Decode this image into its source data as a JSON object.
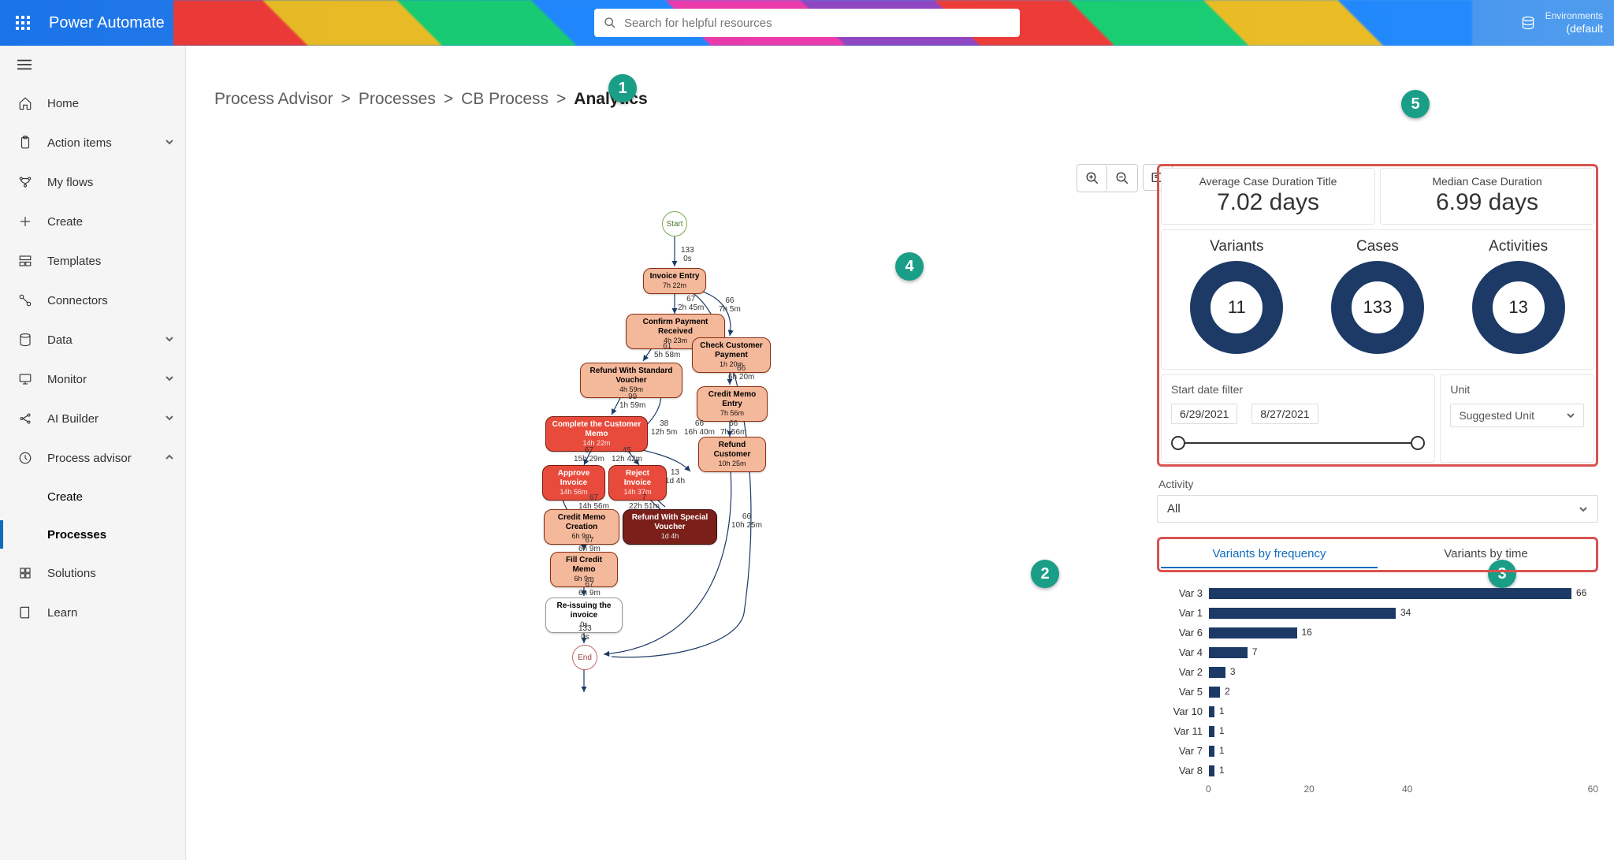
{
  "header": {
    "app_title": "Power Automate",
    "search_placeholder": "Search for helpful resources",
    "env_label": "Environments",
    "env_value": "(default"
  },
  "sidebar": {
    "items": [
      {
        "label": "Home",
        "icon": "home"
      },
      {
        "label": "Action items",
        "icon": "clipboard",
        "chevron": "down"
      },
      {
        "label": "My flows",
        "icon": "flow"
      },
      {
        "label": "Create",
        "icon": "plus"
      },
      {
        "label": "Templates",
        "icon": "templates"
      },
      {
        "label": "Connectors",
        "icon": "connectors"
      },
      {
        "label": "Data",
        "icon": "data",
        "chevron": "down"
      },
      {
        "label": "Monitor",
        "icon": "monitor",
        "chevron": "down"
      },
      {
        "label": "AI Builder",
        "icon": "ai",
        "chevron": "down"
      },
      {
        "label": "Process advisor",
        "icon": "process",
        "chevron": "up"
      }
    ],
    "subitems": [
      {
        "label": "Create"
      },
      {
        "label": "Processes",
        "active": true
      }
    ],
    "tail": [
      {
        "label": "Solutions",
        "icon": "solutions"
      },
      {
        "label": "Learn",
        "icon": "learn"
      }
    ]
  },
  "breadcrumb": {
    "crumbs": [
      "Process Advisor",
      "Processes",
      "CB Process"
    ],
    "current": "Analytics"
  },
  "callouts": {
    "1": "1",
    "2": "2",
    "3": "3",
    "4": "4",
    "5": "5"
  },
  "flow": {
    "start": "Start",
    "end": "End",
    "nodes": {
      "invoice_entry": {
        "t": "Invoice Entry",
        "d": "7h 22m"
      },
      "confirm_payment": {
        "t": "Confirm Payment Received",
        "d": "4h 23m"
      },
      "check_customer": {
        "t": "Check Customer Payment",
        "d": "1h 20m"
      },
      "refund_standard": {
        "t": "Refund With Standard Voucher",
        "d": "4h 59m"
      },
      "credit_memo_entry": {
        "t": "Credit Memo Entry",
        "d": "7h 56m"
      },
      "complete_memo": {
        "t": "Complete the Customer Memo",
        "d": "14h 22m"
      },
      "refund_customer": {
        "t": "Refund Customer",
        "d": "10h 25m"
      },
      "approve_invoice": {
        "t": "Approve Invoice",
        "d": "14h 56m"
      },
      "reject_invoice": {
        "t": "Reject Invoice",
        "d": "14h 37m"
      },
      "refund_special": {
        "t": "Refund With Special Voucher",
        "d": "1d 4h"
      },
      "credit_memo_creation": {
        "t": "Credit Memo Creation",
        "d": "6h 9m"
      },
      "fill_credit_memo": {
        "t": "Fill Credit Memo",
        "d": "6h 9m"
      },
      "reissuing": {
        "t": "Re-issuing the invoice",
        "d": "0s"
      }
    },
    "edge_labels": {
      "e1": {
        "n": "133",
        "d": "0s"
      },
      "e2": {
        "n": "67",
        "d": "2h 45m"
      },
      "e2b": {
        "n": "66",
        "d": "7h 5m"
      },
      "e3": {
        "n": "61",
        "d": "5h 58m"
      },
      "e4": {
        "n": "66",
        "d": "6h 20m"
      },
      "e5": {
        "n": "99",
        "d": "1h 59m"
      },
      "e6": {
        "n": "38",
        "d": "12h 5m"
      },
      "e7": {
        "n": "66",
        "d": "16h 40m"
      },
      "e7b": {
        "n": "66",
        "d": "7h 56m"
      },
      "e8": {
        "n": "67",
        "d": "15h 29m"
      },
      "e9": {
        "n": "45",
        "d": "12h 42m"
      },
      "e10": {
        "n": "13",
        "d": "1d 4h"
      },
      "e11": {
        "n": "67",
        "d": "14h 56m"
      },
      "e12": {
        "n": "7",
        "d": "22h 51m"
      },
      "e13": {
        "n": "67",
        "d": "6h 9m"
      },
      "e14": {
        "n": "67",
        "d": "6h 9m"
      },
      "e15": {
        "n": "133",
        "d": "0s"
      },
      "e16": {
        "n": "66",
        "d": "10h 25m"
      }
    }
  },
  "kpis": {
    "avg_label": "Average Case Duration Title",
    "avg_value": "7.02 days",
    "med_label": "Median Case Duration",
    "med_value": "6.99 days",
    "variants_label": "Variants",
    "variants_value": "11",
    "cases_label": "Cases",
    "cases_value": "133",
    "activities_label": "Activities",
    "activities_value": "13",
    "start_date_label": "Start date filter",
    "date_from": "6/29/2021",
    "date_to": "8/27/2021",
    "unit_label": "Unit",
    "unit_value": "Suggested Unit"
  },
  "activity_filter": {
    "label": "Activity",
    "value": "All"
  },
  "tabs": {
    "freq": "Variants by frequency",
    "time": "Variants by time"
  },
  "chart_data": {
    "type": "bar",
    "orientation": "horizontal",
    "title": "",
    "xlabel": "",
    "ylabel": "",
    "xlim": [
      0,
      66
    ],
    "ticks": [
      0,
      20,
      40,
      60
    ],
    "categories": [
      "Var 3",
      "Var 1",
      "Var 6",
      "Var 4",
      "Var 2",
      "Var 5",
      "Var 10",
      "Var 11",
      "Var 7",
      "Var 8"
    ],
    "values": [
      66,
      34,
      16,
      7,
      3,
      2,
      1,
      1,
      1,
      1
    ]
  }
}
